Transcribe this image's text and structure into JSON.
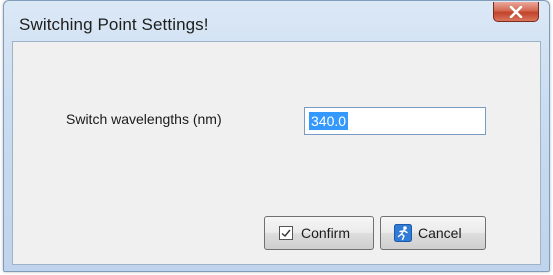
{
  "window": {
    "title": "Switching Point Settings!"
  },
  "form": {
    "wavelength_label": "Switch wavelengths (nm)",
    "wavelength_value": "340.0"
  },
  "buttons": {
    "confirm_label": "Confirm",
    "cancel_label": "Cancel",
    "close_icon": "close-icon",
    "confirm_icon": "checkbox-check-icon",
    "cancel_icon": "running-person-icon"
  },
  "colors": {
    "selection": "#3399ff",
    "close_button": "#c2432a",
    "cancel_icon": "#2f7bd6"
  }
}
